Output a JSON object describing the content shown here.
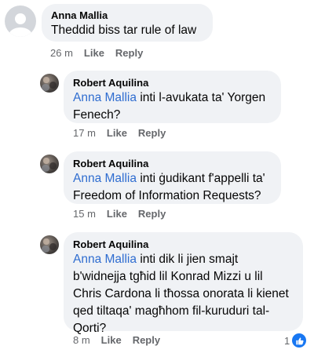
{
  "comments": [
    {
      "author": "Anna Mallia",
      "text": "Theddid  biss tar rule of law",
      "time": "26 m",
      "like": "Like",
      "reply": "Reply"
    }
  ],
  "replies": [
    {
      "author": "Robert Aquilina",
      "mention": "Anna Mallia",
      "line1": "inti l-avukata ta' Yorgen",
      "line2": "Fenech?",
      "time": "17 m",
      "like": "Like",
      "reply": "Reply"
    },
    {
      "author": "Robert Aquilina",
      "mention": "Anna Mallia",
      "line1": "inti ġudikant f'appelli ta'",
      "line2": "Freedom of Information Requests?",
      "time": "15 m",
      "like": "Like",
      "reply": "Reply"
    },
    {
      "author": "Robert Aquilina",
      "mention": "Anna Mallia",
      "line1": "inti dik li jien smajt",
      "line2": "b'widnejja tgħid lil Konrad Mizzi u lil",
      "line3": "Chris Cardona li tħossa onorata li kienet",
      "line4": "qed tiltaqa' magħhom fil-kuruduri tal-",
      "line5": "Qorti?",
      "time": "8 m",
      "like": "Like",
      "reply": "Reply",
      "reaction_count": "1"
    }
  ],
  "icons": {
    "anon_avatar": "default-avatar-icon",
    "photo_avatar": "profile-photo-icon",
    "reaction": "thumbs-up-icon"
  },
  "colors": {
    "bubble": "#f0f2f5",
    "mention": "#2f6dd0",
    "meta": "#65676b",
    "like_reaction": "#1877f2"
  }
}
